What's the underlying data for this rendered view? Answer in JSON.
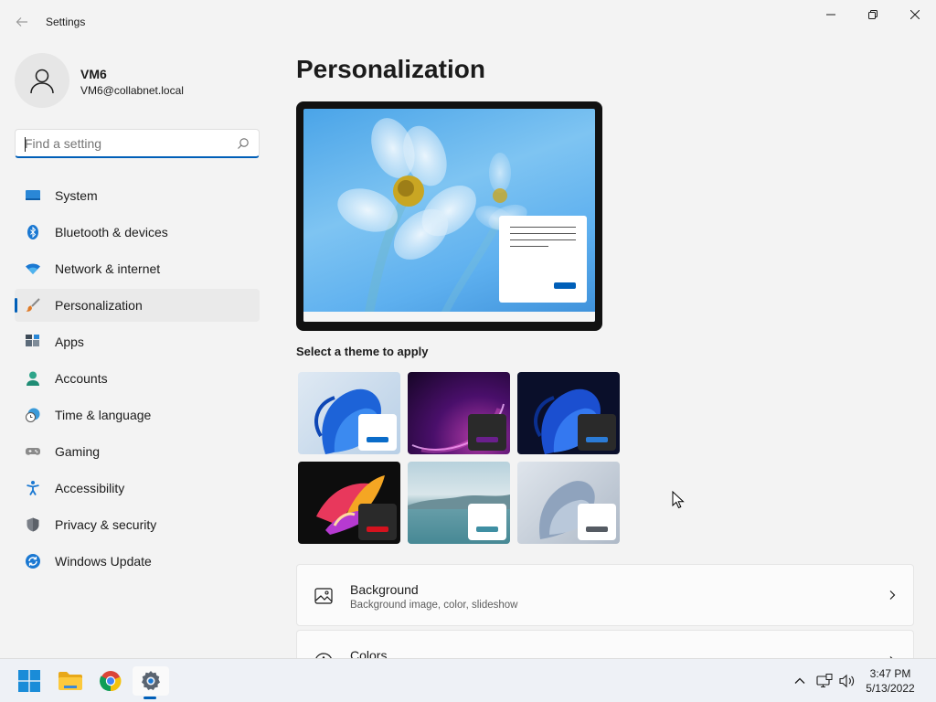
{
  "window": {
    "title": "Settings"
  },
  "profile": {
    "name": "VM6",
    "email": "VM6@collabnet.local"
  },
  "search": {
    "placeholder": "Find a setting",
    "value": ""
  },
  "sidebar": {
    "items": [
      {
        "label": "System",
        "icon": "system-icon",
        "active": false
      },
      {
        "label": "Bluetooth & devices",
        "icon": "bluetooth-icon",
        "active": false
      },
      {
        "label": "Network & internet",
        "icon": "wifi-icon",
        "active": false
      },
      {
        "label": "Personalization",
        "icon": "brush-icon",
        "active": true
      },
      {
        "label": "Apps",
        "icon": "apps-icon",
        "active": false
      },
      {
        "label": "Accounts",
        "icon": "accounts-icon",
        "active": false
      },
      {
        "label": "Time & language",
        "icon": "clock-globe-icon",
        "active": false
      },
      {
        "label": "Gaming",
        "icon": "gamepad-icon",
        "active": false
      },
      {
        "label": "Accessibility",
        "icon": "accessibility-icon",
        "active": false
      },
      {
        "label": "Privacy & security",
        "icon": "shield-icon",
        "active": false
      },
      {
        "label": "Windows Update",
        "icon": "update-icon",
        "active": false
      }
    ]
  },
  "main": {
    "title": "Personalization",
    "themes_label": "Select a theme to apply",
    "themes": [
      {
        "name": "windows-light",
        "accent": "#0a6cc9",
        "swatch": "#ffffff"
      },
      {
        "name": "glow",
        "accent": "#6a1f8c",
        "swatch": "#2a2a2a"
      },
      {
        "name": "windows-dark",
        "accent": "#2b7bd6",
        "swatch": "#2a2a2a"
      },
      {
        "name": "captured-motion",
        "accent": "#d4121e",
        "swatch": "#2a2a2a"
      },
      {
        "name": "sunrise",
        "accent": "#3f8fa3",
        "swatch": "#ffffff"
      },
      {
        "name": "flow",
        "accent": "#555b63",
        "swatch": "#ffffff"
      }
    ],
    "cards": [
      {
        "title": "Background",
        "subtitle": "Background image, color, slideshow",
        "icon": "image-icon"
      },
      {
        "title": "Colors",
        "subtitle": "",
        "icon": "palette-icon"
      }
    ]
  },
  "taskbar": {
    "apps": [
      "start-icon",
      "file-explorer-icon",
      "chrome-icon",
      "settings-icon"
    ],
    "clock": {
      "time": "3:47 PM",
      "date": "5/13/2022"
    }
  },
  "colors": {
    "accent": "#005fb8",
    "background": "#f3f3f3"
  }
}
